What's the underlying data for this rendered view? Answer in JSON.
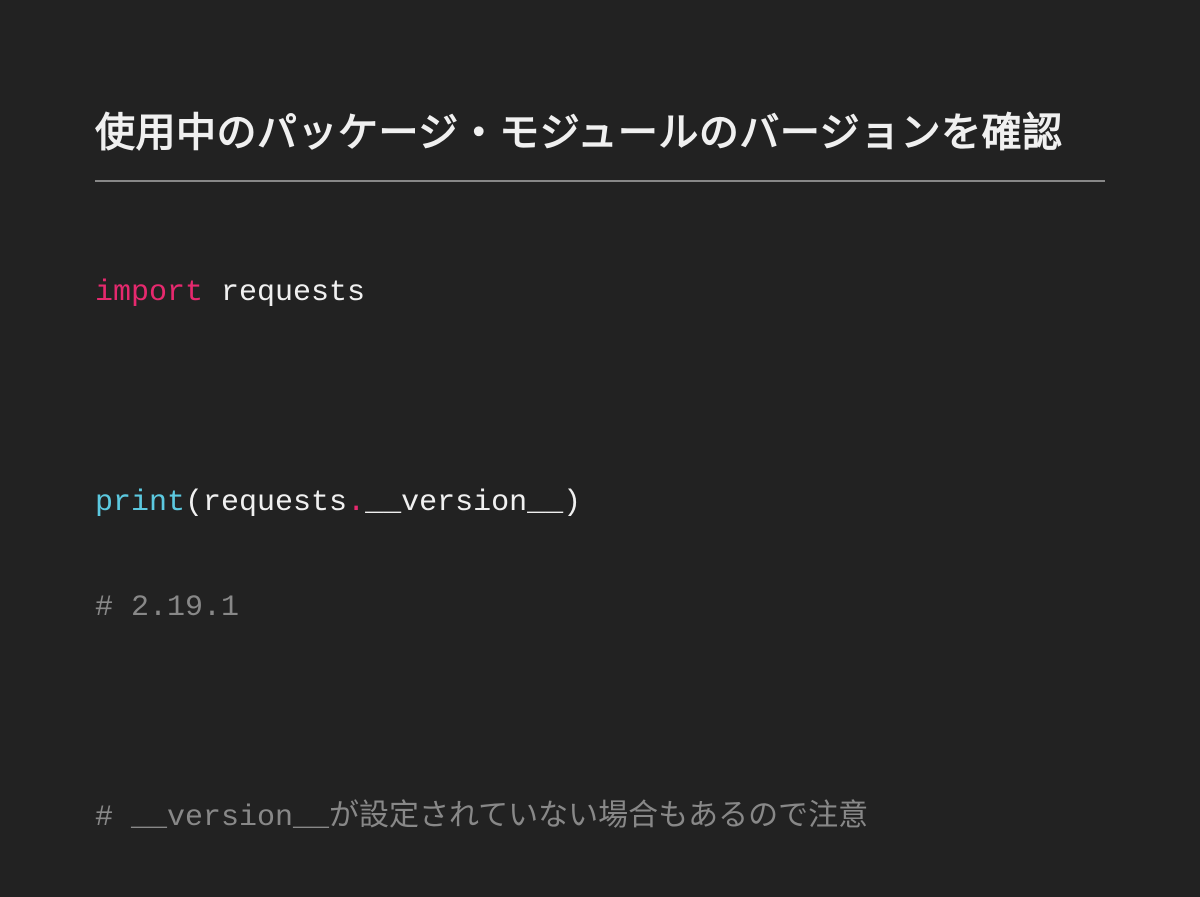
{
  "title": "使用中のパッケージ・モジュールのバージョンを確認",
  "code": {
    "line1": {
      "import_kw": "import",
      "module": " requests"
    },
    "line3": {
      "func": "print",
      "open": "(",
      "obj": "requests",
      "dot": ".",
      "attr": "__version__",
      "close": ")"
    },
    "line4": "# 2.19.1",
    "line6": "# __version__が設定されていない場合もあるので注意"
  }
}
